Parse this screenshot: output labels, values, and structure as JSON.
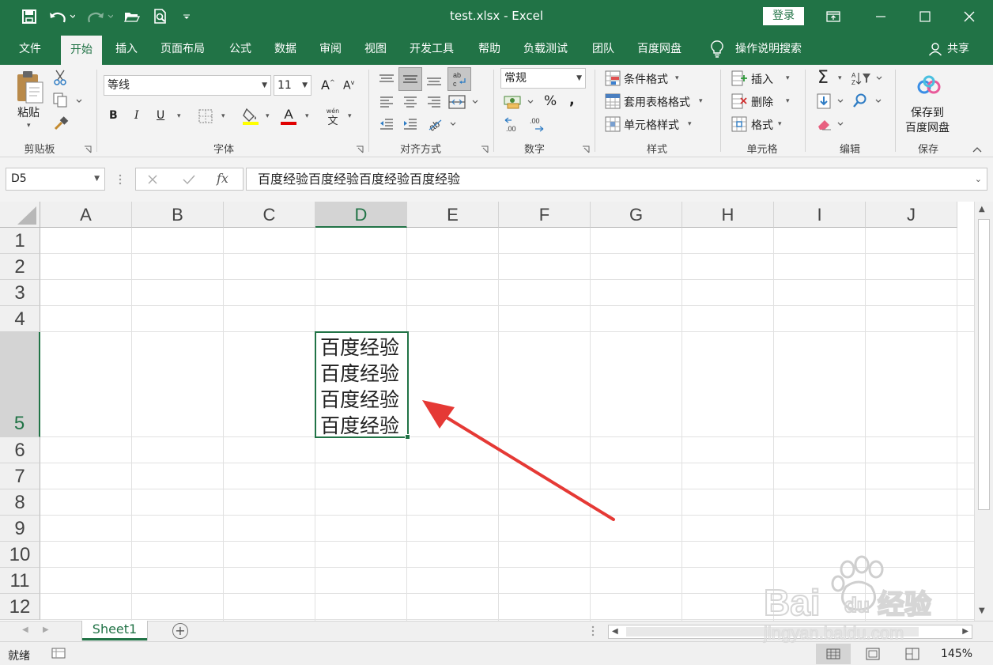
{
  "app": {
    "title": "test.xlsx  -  Excel",
    "login_label": "登录",
    "share_label": "共享"
  },
  "menu": {
    "tabs": [
      "文件",
      "开始",
      "插入",
      "页面布局",
      "公式",
      "数据",
      "审阅",
      "视图",
      "开发工具",
      "帮助",
      "负载测试",
      "团队",
      "百度网盘"
    ],
    "active_tab": "开始",
    "search_label": "操作说明搜索"
  },
  "ribbon": {
    "clipboard": {
      "paste_label": "粘贴",
      "group_label": "剪贴板"
    },
    "font": {
      "font_name": "等线",
      "font_size": "11",
      "bold": "B",
      "italic": "I",
      "underline": "U",
      "grow": "A",
      "shrink": "A",
      "font_color_letter": "A",
      "phonetic_top": "wén",
      "phonetic_bottom": "文",
      "group_label": "字体",
      "fill_color": "#ffff00",
      "font_color": "#e00000"
    },
    "alignment": {
      "group_label": "对齐方式"
    },
    "number": {
      "format": "常规",
      "percent": "%",
      "comma": ",",
      "inc_decimal": ".00",
      "dec_decimal": ".00",
      "group_label": "数字"
    },
    "styles": {
      "conditional": "条件格式",
      "table": "套用表格格式",
      "cell_styles": "单元格样式",
      "group_label": "样式"
    },
    "cells": {
      "insert": "插入",
      "delete": "删除",
      "format": "格式",
      "group_label": "单元格"
    },
    "editing": {
      "sum": "Σ",
      "group_label": "编辑"
    },
    "save": {
      "label_line1": "保存到",
      "label_line2": "百度网盘",
      "group_label": "保存"
    }
  },
  "formula_bar": {
    "name_box": "D5",
    "fx": "fx",
    "value": "百度经验百度经验百度经验百度经验"
  },
  "sheet": {
    "columns": [
      "A",
      "B",
      "C",
      "D",
      "E",
      "F",
      "G",
      "H",
      "I",
      "J"
    ],
    "rows": [
      "1",
      "2",
      "3",
      "4",
      "5",
      "6",
      "7",
      "8",
      "9",
      "10",
      "11",
      "12"
    ],
    "selected_column": "D",
    "selected_row": "5",
    "active_cell_text": "百度经验百度经验百度经验百度经验"
  },
  "sheet_tabs": {
    "tabs": [
      "Sheet1"
    ],
    "add_label": "+"
  },
  "status": {
    "ready": "就绪",
    "zoom": "145%"
  },
  "watermark": {
    "text": "Bai 经验",
    "url": "jingyan.baidu.com"
  },
  "colors": {
    "excel_green": "#217346",
    "arrow_red": "#e53935"
  }
}
